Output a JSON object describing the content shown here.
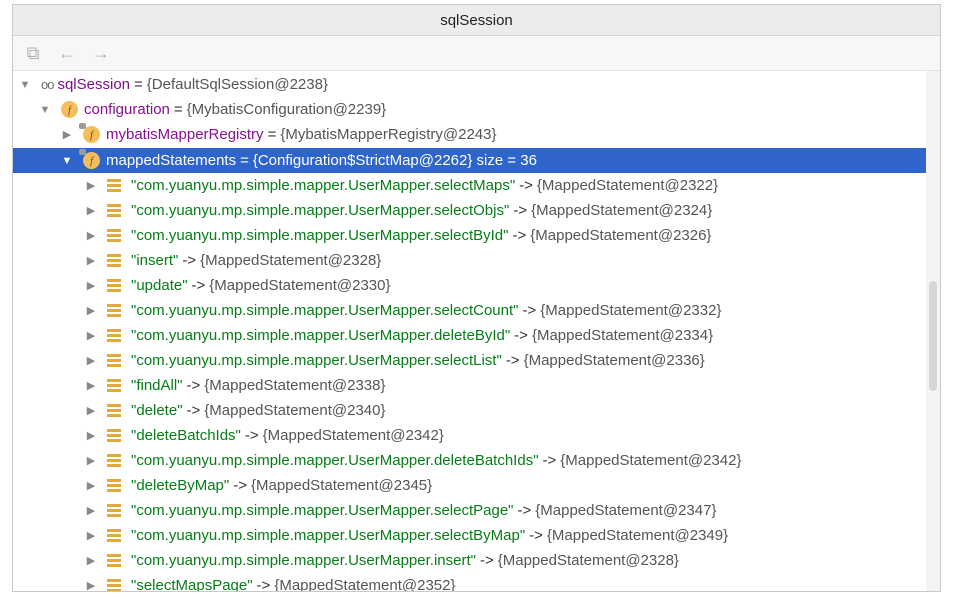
{
  "window": {
    "title": "sqlSession"
  },
  "toolbar": {
    "buttons": [
      {
        "icon": "restore-layout-icon",
        "glyph": "⧉"
      },
      {
        "icon": "back-arrow-icon",
        "glyph": "←"
      },
      {
        "icon": "forward-arrow-icon",
        "glyph": "→"
      }
    ]
  },
  "tree": {
    "root": {
      "name": "sqlSession",
      "eq": "=",
      "value": "{DefaultSqlSession@2238}",
      "icon": "watch-glasses-icon"
    },
    "configuration": {
      "name": "configuration",
      "eq": "=",
      "value": "{MybatisConfiguration@2239}",
      "icon": "field-icon"
    },
    "registry": {
      "name": "mybatisMapperRegistry",
      "eq": "=",
      "value": "{MybatisMapperRegistry@2243}",
      "icon": "field-icon-locked"
    },
    "mapped": {
      "name": "mappedStatements",
      "eq": "=",
      "value": "{Configuration$StrictMap@2262}  size = 36",
      "icon": "field-icon-locked"
    },
    "entries": [
      {
        "key": "\"com.yuanyu.mp.simple.mapper.UserMapper.selectMaps\"",
        "arrow": "->",
        "value": "{MappedStatement@2322}"
      },
      {
        "key": "\"com.yuanyu.mp.simple.mapper.UserMapper.selectObjs\"",
        "arrow": "->",
        "value": "{MappedStatement@2324}"
      },
      {
        "key": "\"com.yuanyu.mp.simple.mapper.UserMapper.selectById\"",
        "arrow": "->",
        "value": "{MappedStatement@2326}"
      },
      {
        "key": "\"insert\"",
        "arrow": "->",
        "value": "{MappedStatement@2328}"
      },
      {
        "key": "\"update\"",
        "arrow": "->",
        "value": "{MappedStatement@2330}"
      },
      {
        "key": "\"com.yuanyu.mp.simple.mapper.UserMapper.selectCount\"",
        "arrow": "->",
        "value": "{MappedStatement@2332}"
      },
      {
        "key": "\"com.yuanyu.mp.simple.mapper.UserMapper.deleteById\"",
        "arrow": "->",
        "value": "{MappedStatement@2334}"
      },
      {
        "key": "\"com.yuanyu.mp.simple.mapper.UserMapper.selectList\"",
        "arrow": "->",
        "value": "{MappedStatement@2336}"
      },
      {
        "key": "\"findAll\"",
        "arrow": "->",
        "value": "{MappedStatement@2338}"
      },
      {
        "key": "\"delete\"",
        "arrow": "->",
        "value": "{MappedStatement@2340}"
      },
      {
        "key": "\"deleteBatchIds\"",
        "arrow": "->",
        "value": "{MappedStatement@2342}"
      },
      {
        "key": "\"com.yuanyu.mp.simple.mapper.UserMapper.deleteBatchIds\"",
        "arrow": "->",
        "value": "{MappedStatement@2342}"
      },
      {
        "key": "\"deleteByMap\"",
        "arrow": "->",
        "value": "{MappedStatement@2345}"
      },
      {
        "key": "\"com.yuanyu.mp.simple.mapper.UserMapper.selectPage\"",
        "arrow": "->",
        "value": "{MappedStatement@2347}"
      },
      {
        "key": "\"com.yuanyu.mp.simple.mapper.UserMapper.selectByMap\"",
        "arrow": "->",
        "value": "{MappedStatement@2349}"
      },
      {
        "key": "\"com.yuanyu.mp.simple.mapper.UserMapper.insert\"",
        "arrow": "->",
        "value": "{MappedStatement@2328}"
      },
      {
        "key": "\"selectMapsPage\"",
        "arrow": "->",
        "value": "{MappedStatement@2352}"
      }
    ]
  },
  "colors": {
    "selection": "#2f65ca",
    "string": "#067d17",
    "field": "#871094",
    "field_icon": "#f3be5b"
  }
}
